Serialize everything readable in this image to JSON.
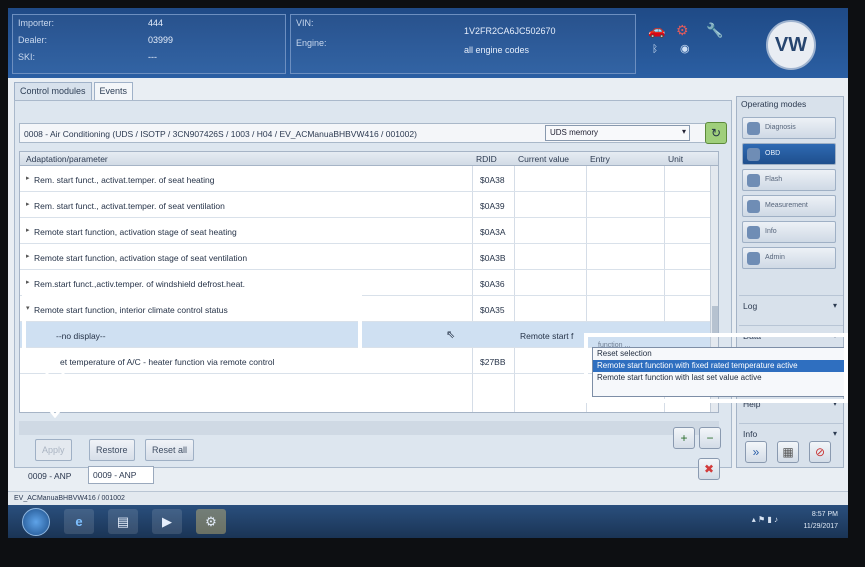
{
  "header": {
    "importer_label": "Importer:",
    "importer_value": "444",
    "dealer_label": "Dealer:",
    "dealer_value": "03999",
    "ski_label": "SKI:",
    "ski_value": "---",
    "vin_label": "VIN:",
    "vin_value": "1V2FR2CA6JC502670",
    "engine_label": "Engine:",
    "engine_value": "all engine codes"
  },
  "tabs": [
    "Control modules",
    "Events"
  ],
  "path": {
    "text": "0008 - Air Conditioning  (UDS / ISOTP / 3CN907426S / 1003 / H04 / EV_ACManuaBHBVW416 / 001002)",
    "memory_select": "UDS memory"
  },
  "table": {
    "headers": {
      "param": "Adaptation/parameter",
      "rdid": "RDID",
      "current": "Current value",
      "entry": "Entry",
      "unit": "Unit"
    },
    "rows": [
      {
        "label": "Rem. start funct., activat.temper. of seat heating",
        "rdid": "$0A38"
      },
      {
        "label": "Rem. start funct., activat.temper. of seat ventilation",
        "rdid": "$0A39"
      },
      {
        "label": "Remote start function, activation stage of seat heating",
        "rdid": "$0A3A"
      },
      {
        "label": "Remote start function, activation stage of seat ventilation",
        "rdid": "$0A3B"
      },
      {
        "label": "Rem.start funct.,activ.temper. of windshield defrost.heat.",
        "rdid": "$0A36"
      },
      {
        "label": "Remote start function, interior climate control status",
        "rdid": "$0A35"
      }
    ],
    "sub_row": {
      "label": "--no display--",
      "current": "Remote start f"
    },
    "last_row": {
      "label": "et temperature of A/C - heater function via remote control",
      "rdid": "$27BB"
    }
  },
  "dropdown": {
    "top_hint": "function ...",
    "options": [
      "Reset selection",
      "Remote start function with fixed rated temperature active",
      "Remote start function with last set value active"
    ],
    "selected_index": 1
  },
  "buttons": {
    "apply": "Apply",
    "restore": "Restore",
    "reset_all": "Reset all"
  },
  "fields": {
    "label": "0009 - ANP",
    "value": "0009 - ANP"
  },
  "right_panel": {
    "title": "Operating modes",
    "modes": [
      "Diagnosis",
      "OBD",
      "Flash",
      "Measurement",
      "Info",
      "Admin"
    ],
    "active_mode_index": 1,
    "sections": [
      "Log",
      "Data",
      "Help",
      "Info"
    ]
  },
  "status": {
    "text": "EV_ACManuaBHBVW416 / 001002"
  },
  "taskbar": {
    "time": "8:57 PM",
    "date": "11/29/2017"
  }
}
